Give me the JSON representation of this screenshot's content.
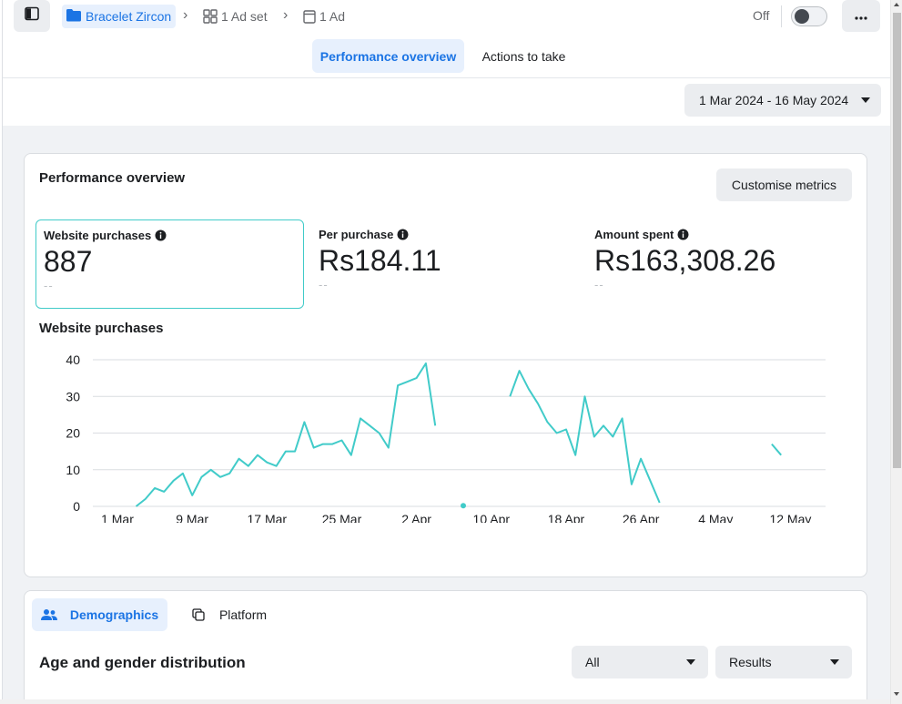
{
  "breadcrumb": {
    "campaign": "Bracelet Zircon",
    "adset": "1 Ad set",
    "ad": "1 Ad"
  },
  "status": {
    "toggle_label": "Off"
  },
  "tabs": [
    {
      "label": "Performance overview",
      "active": true
    },
    {
      "label": "Actions to take",
      "active": false
    }
  ],
  "date_range": "1 Mar 2024 - 16 May 2024",
  "performance": {
    "title": "Performance overview",
    "customise_label": "Customise metrics",
    "metrics": [
      {
        "label": "Website purchases",
        "value": "887",
        "delta": "--"
      },
      {
        "label": "Per purchase",
        "value": "Rs184.11",
        "delta": "--"
      },
      {
        "label": "Amount spent",
        "value": "Rs163,308.26",
        "delta": "--"
      }
    ]
  },
  "chart_data": {
    "type": "line",
    "title": "Website purchases",
    "xlabel": "",
    "ylabel": "",
    "ylim": [
      0,
      40
    ],
    "yticks": [
      0,
      10,
      20,
      30,
      40
    ],
    "x_tick_labels": [
      "1 Mar",
      "9 Mar",
      "17 Mar",
      "25 Mar",
      "2 Apr",
      "10 Apr",
      "18 Apr",
      "26 Apr",
      "4 May",
      "12 May"
    ],
    "x_tick_day_index": [
      0,
      8,
      16,
      24,
      32,
      40,
      48,
      56,
      64,
      72
    ],
    "grid": true,
    "color": "#41cbc9",
    "segments": [
      {
        "start_day_index": 2,
        "values": [
          0,
          2,
          5,
          4,
          7,
          9,
          3,
          8,
          10,
          8,
          9,
          13,
          11,
          14,
          12,
          11,
          15,
          15,
          23,
          16,
          17,
          17,
          18,
          14,
          24,
          22,
          20,
          16,
          33,
          34,
          35,
          39,
          22
        ]
      },
      {
        "start_day_index": 37,
        "values": [
          0.2
        ]
      },
      {
        "start_day_index": 42,
        "values": [
          30,
          37,
          32,
          28,
          23,
          20,
          21,
          14,
          30,
          19,
          22,
          19,
          24,
          6,
          13,
          7,
          1
        ]
      },
      {
        "start_day_index": 70,
        "values": [
          17,
          14
        ]
      }
    ]
  },
  "demographics": {
    "tabs": [
      {
        "label": "Demographics",
        "active": true
      },
      {
        "label": "Platform",
        "active": false
      }
    ],
    "title": "Age and gender distribution",
    "filter_selected": "All",
    "metric_selected": "Results"
  }
}
